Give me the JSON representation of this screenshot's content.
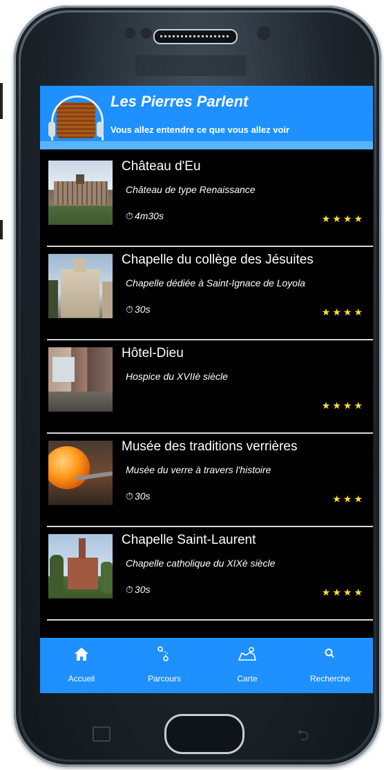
{
  "app": {
    "title": "Les Pierres Parlent",
    "subtitle": "Vous allez entendre ce que vous allez voir"
  },
  "colors": {
    "header_blue": "#1e90ff",
    "accent_light_blue": "#59b4ff",
    "background": "#000000",
    "star_yellow": "#ffe033"
  },
  "places": [
    {
      "title": "Château d'Eu",
      "description": "Château de type Renaissance",
      "duration": "4m30s",
      "stars": "★★★★",
      "rating": 4,
      "image": "chateau-photo"
    },
    {
      "title": "Chapelle du collège des Jésuites",
      "description": "Chapelle dédiée à Saint-Ignace de Loyola",
      "duration": "30s",
      "stars": "★★★★",
      "rating": 4,
      "image": "chapel-jesuits-photo"
    },
    {
      "title": "Hôtel-Dieu",
      "description": "Hospice du XVIIè siècle",
      "duration": "",
      "stars": "★★★★",
      "rating": 4,
      "image": "hotel-dieu-photo"
    },
    {
      "title": "Musée des traditions verrières",
      "description": "Musée du verre à travers l'histoire",
      "duration": "30s",
      "stars": "★★★",
      "rating": 3,
      "image": "glass-museum-photo"
    },
    {
      "title": "Chapelle Saint-Laurent",
      "description": "Chapelle catholique du XIXè siècle",
      "duration": "30s",
      "stars": "★★★★",
      "rating": 4,
      "image": "chapel-saint-laurent-photo"
    }
  ],
  "nav": [
    {
      "label": "Accueil",
      "icon": "home-icon"
    },
    {
      "label": "Parcours",
      "icon": "route-icon"
    },
    {
      "label": "Carte",
      "icon": "map-icon"
    },
    {
      "label": "Recherche",
      "icon": "search-icon"
    }
  ]
}
